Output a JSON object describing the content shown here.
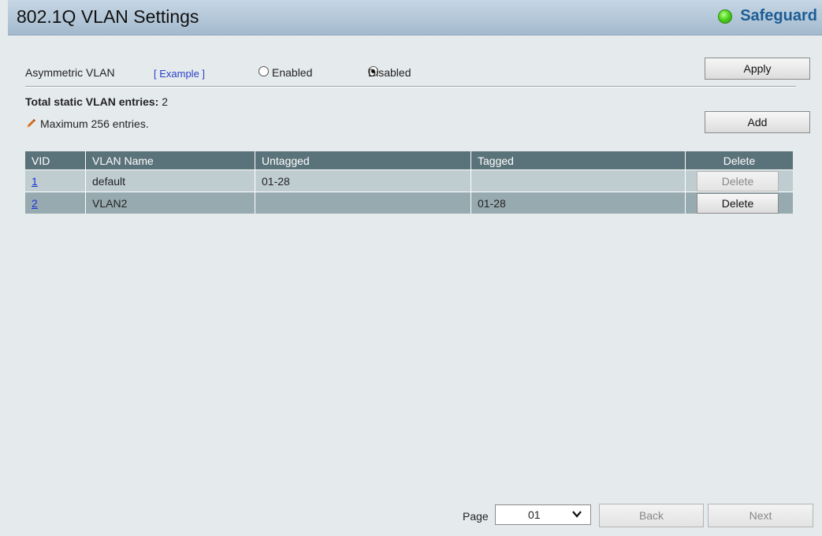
{
  "header": {
    "title": "802.1Q VLAN Settings",
    "safeguard_label": "Safeguard",
    "safeguard_color": "#4fd41e"
  },
  "asymmetric": {
    "label": "Asymmetric VLAN",
    "example_link": "[ Example ]",
    "enabled_label": "Enabled",
    "disabled_label": "Disabled",
    "selected": "Disabled",
    "apply_label": "Apply"
  },
  "summary": {
    "total_label": "Total static VLAN entries:",
    "total_value": "2",
    "max_note": "Maximum 256 entries.",
    "add_label": "Add"
  },
  "table": {
    "columns": [
      "VID",
      "VLAN Name",
      "Untagged",
      "Tagged",
      "Delete"
    ],
    "rows": [
      {
        "vid": "1",
        "name": "default",
        "untagged": "01-28",
        "tagged": "",
        "delete_label": "Delete",
        "delete_enabled": false
      },
      {
        "vid": "2",
        "name": "VLAN2",
        "untagged": "",
        "tagged": "01-28",
        "delete_label": "Delete",
        "delete_enabled": true
      }
    ]
  },
  "pagination": {
    "page_label": "Page",
    "page_value": "01",
    "back_label": "Back",
    "next_label": "Next"
  }
}
